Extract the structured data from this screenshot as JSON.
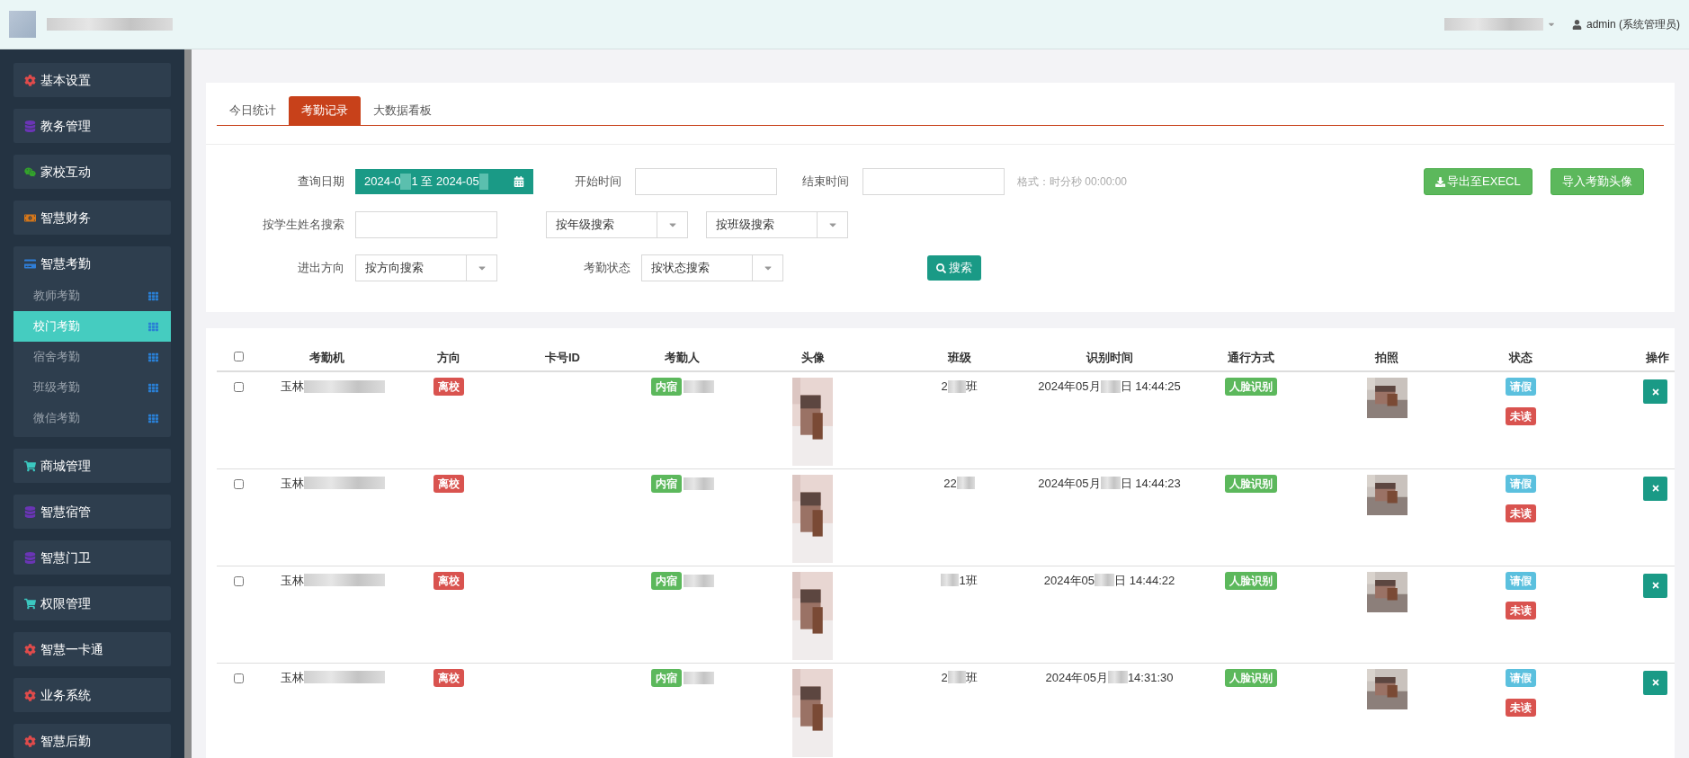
{
  "header": {
    "user": "admin (系统管理员)"
  },
  "sidebar": {
    "items": [
      {
        "label": "基本设置"
      },
      {
        "label": "教务管理"
      },
      {
        "label": "家校互动"
      },
      {
        "label": "智慧财务"
      },
      {
        "label": "智慧考勤",
        "children": [
          {
            "label": "教师考勤",
            "selected": false
          },
          {
            "label": "校门考勤",
            "selected": true
          },
          {
            "label": "宿舍考勤",
            "selected": false
          },
          {
            "label": "班级考勤",
            "selected": false
          },
          {
            "label": "微信考勤",
            "selected": false
          }
        ]
      },
      {
        "label": "商城管理"
      },
      {
        "label": "智慧宿管"
      },
      {
        "label": "智慧门卫"
      },
      {
        "label": "权限管理"
      },
      {
        "label": "智慧一卡通"
      },
      {
        "label": "业务系统"
      },
      {
        "label": "智慧后勤"
      }
    ]
  },
  "tabs": [
    {
      "label": "今日统计",
      "selected": false
    },
    {
      "label": "考勤记录",
      "selected": true
    },
    {
      "label": "大数据看板",
      "selected": false
    }
  ],
  "filters": {
    "date_label": "查询日期",
    "date_parts": [
      "2024-0",
      "1 至 2024-05"
    ],
    "start_label": "开始时间",
    "end_label": "结束时间",
    "format_hint": "格式：时分秒 00:00:00",
    "export_button": "导出至EXECL",
    "import_button": "导入考勤头像",
    "name_label": "按学生姓名搜索",
    "grade_select": "按年级搜索",
    "class_select": "按班级搜索",
    "direction_label": "进出方向",
    "direction_select": "按方向搜索",
    "status_label": "考勤状态",
    "status_select": "按状态搜索",
    "search_button": "搜索"
  },
  "table": {
    "select_all_checked": false,
    "columns": [
      "考勤机",
      "方向",
      "卡号ID",
      "考勤人",
      "头像",
      "班级",
      "识别时间",
      "通行方式",
      "拍照",
      "状态",
      "操作"
    ],
    "rows": [
      {
        "checked": false,
        "device": "玉林",
        "direction": "离校",
        "person_tag": "内宿",
        "class_parts": [
          "2",
          "班"
        ],
        "time_parts": [
          "2024年05月",
          "日 14:44:25"
        ],
        "method": "人脸识别",
        "statuses": [
          "请假",
          "未读"
        ]
      },
      {
        "checked": false,
        "device": "玉林",
        "direction": "离校",
        "person_tag": "内宿",
        "class_parts": [
          "22"
        ],
        "time_parts": [
          "2024年05月",
          "日 14:44:23"
        ],
        "method": "人脸识别",
        "statuses": [
          "请假",
          "未读"
        ]
      },
      {
        "checked": false,
        "device": "玉林",
        "direction": "离校",
        "person_tag": "内宿",
        "class_parts": [
          "1班"
        ],
        "class_blur_first": true,
        "time_parts": [
          "2024年05",
          "日 14:44:22"
        ],
        "method": "人脸识别",
        "statuses": [
          "请假",
          "未读"
        ]
      },
      {
        "checked": false,
        "device": "玉林",
        "direction": "离校",
        "person_tag": "内宿",
        "class_parts": [
          "2",
          "班"
        ],
        "time_parts": [
          "2024年05月",
          " 14:31:30"
        ],
        "method": "人脸识别",
        "statuses": [
          "请假",
          "未读"
        ]
      }
    ]
  }
}
